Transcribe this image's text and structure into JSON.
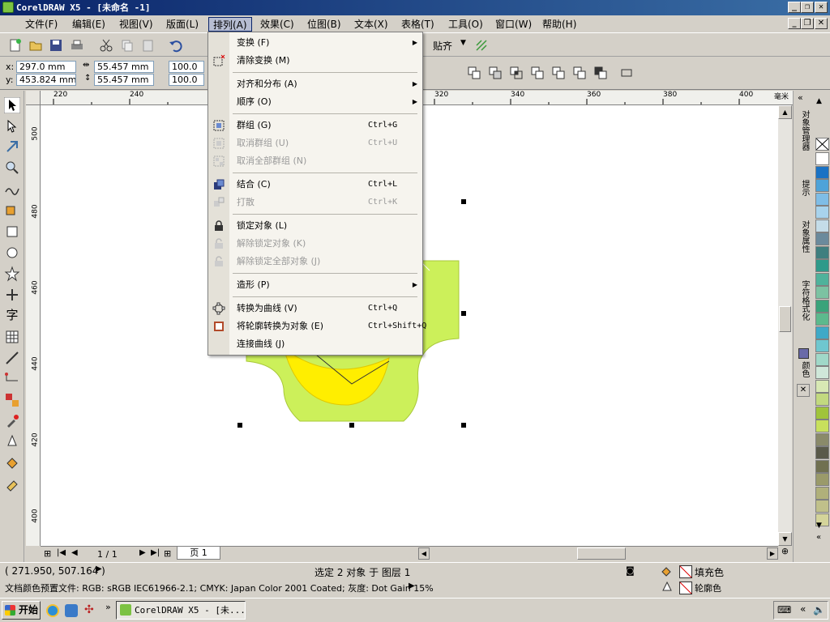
{
  "title": "CorelDRAW X5 - [未命名 -1]",
  "menu": [
    "文件(F)",
    "编辑(E)",
    "视图(V)",
    "版面(L)",
    "排列(A)",
    "效果(C)",
    "位图(B)",
    "文本(X)",
    "表格(T)",
    "工具(O)",
    "窗口(W)",
    "帮助(H)"
  ],
  "toolbar": {
    "paste_label": "贴齐"
  },
  "props": {
    "x_label": "x:",
    "y_label": "y:",
    "x": "297.0 mm",
    "y": "453.824 mm",
    "w": "55.457 mm",
    "h": "55.457 mm",
    "sx": "100.0",
    "sy": "100.0"
  },
  "ruler_top": [
    "220",
    "240",
    "320",
    "340",
    "360",
    "380",
    "400",
    "毫米"
  ],
  "ruler_left": [
    "500",
    "480",
    "460",
    "440",
    "420",
    "400"
  ],
  "arrange_menu": [
    {
      "label": "变换 (F)",
      "shortcut": "",
      "submenu": true,
      "disabled": false,
      "icon": ""
    },
    {
      "label": "清除变换 (M)",
      "shortcut": "",
      "submenu": false,
      "disabled": false,
      "icon": "clear-transform-icon"
    },
    {
      "sep": true
    },
    {
      "label": "对齐和分布 (A)",
      "shortcut": "",
      "submenu": true,
      "disabled": false,
      "icon": ""
    },
    {
      "label": "顺序 (O)",
      "shortcut": "",
      "submenu": true,
      "disabled": false,
      "icon": ""
    },
    {
      "sep": true
    },
    {
      "label": "群组 (G)",
      "shortcut": "Ctrl+G",
      "submenu": false,
      "disabled": false,
      "icon": "group-icon"
    },
    {
      "label": "取消群组 (U)",
      "shortcut": "Ctrl+U",
      "submenu": false,
      "disabled": true,
      "icon": "ungroup-icon"
    },
    {
      "label": "取消全部群组 (N)",
      "shortcut": "",
      "submenu": false,
      "disabled": true,
      "icon": "ungroup-all-icon"
    },
    {
      "sep": true
    },
    {
      "label": "结合 (C)",
      "shortcut": "Ctrl+L",
      "submenu": false,
      "disabled": false,
      "icon": "combine-icon"
    },
    {
      "label": "打散",
      "shortcut": "Ctrl+K",
      "submenu": false,
      "disabled": true,
      "icon": "break-apart-icon"
    },
    {
      "sep": true
    },
    {
      "label": "锁定对象 (L)",
      "shortcut": "",
      "submenu": false,
      "disabled": false,
      "icon": "lock-icon"
    },
    {
      "label": "解除锁定对象 (K)",
      "shortcut": "",
      "submenu": false,
      "disabled": true,
      "icon": "unlock-icon"
    },
    {
      "label": "解除锁定全部对象 (J)",
      "shortcut": "",
      "submenu": false,
      "disabled": true,
      "icon": "unlock-all-icon"
    },
    {
      "sep": true
    },
    {
      "label": "造形 (P)",
      "shortcut": "",
      "submenu": true,
      "disabled": false,
      "icon": ""
    },
    {
      "sep": true
    },
    {
      "label": "转换为曲线 (V)",
      "shortcut": "Ctrl+Q",
      "submenu": false,
      "disabled": false,
      "icon": "convert-curves-icon"
    },
    {
      "label": "将轮廓转换为对象 (E)",
      "shortcut": "Ctrl+Shift+Q",
      "submenu": false,
      "disabled": false,
      "icon": "outline-object-icon"
    },
    {
      "label": "连接曲线 (J)",
      "shortcut": "",
      "submenu": false,
      "disabled": false,
      "icon": ""
    }
  ],
  "dock_tabs": [
    "对象管理器",
    "提示",
    "对象属性",
    "字符格式化",
    "颜色"
  ],
  "page": {
    "counter": "1 / 1",
    "tab": "页 1"
  },
  "status": {
    "coords": "( 271.950, 507.164 )",
    "selection": "选定 2 对象 于 图层 1",
    "fill_label": "填充色",
    "outline_label": "轮廓色"
  },
  "status2": "文档颜色预置文件: RGB: sRGB IEC61966-2.1; CMYK: Japan Color 2001 Coated; 灰度: Dot Gain 15%",
  "taskbar": {
    "start": "开始",
    "task": "CorelDRAW X5 - [未..."
  },
  "colors": {
    "lime": "#ccf05a",
    "lemon": "#ffee00",
    "accent": "#0a246a"
  },
  "palette": [
    "#ffffff",
    "#1a72c4",
    "#4ea3d9",
    "#7fbde6",
    "#a8d3ec",
    "#c4dce8",
    "#6b8a9c",
    "#3f7f7f",
    "#2e9a8a",
    "#4fb29b",
    "#7cc2a2",
    "#3aa37a",
    "#5cb98d",
    "#3fa9c7",
    "#6fc7cf",
    "#a0d8c8",
    "#cfe7d9",
    "#d8e8b4",
    "#c2d97f",
    "#a0c43b",
    "#c8e05c",
    "#8a8a6a",
    "#5a5a4a",
    "#707050",
    "#9a9a6a",
    "#b0b07a",
    "#c0c08a",
    "#d4d49a"
  ]
}
